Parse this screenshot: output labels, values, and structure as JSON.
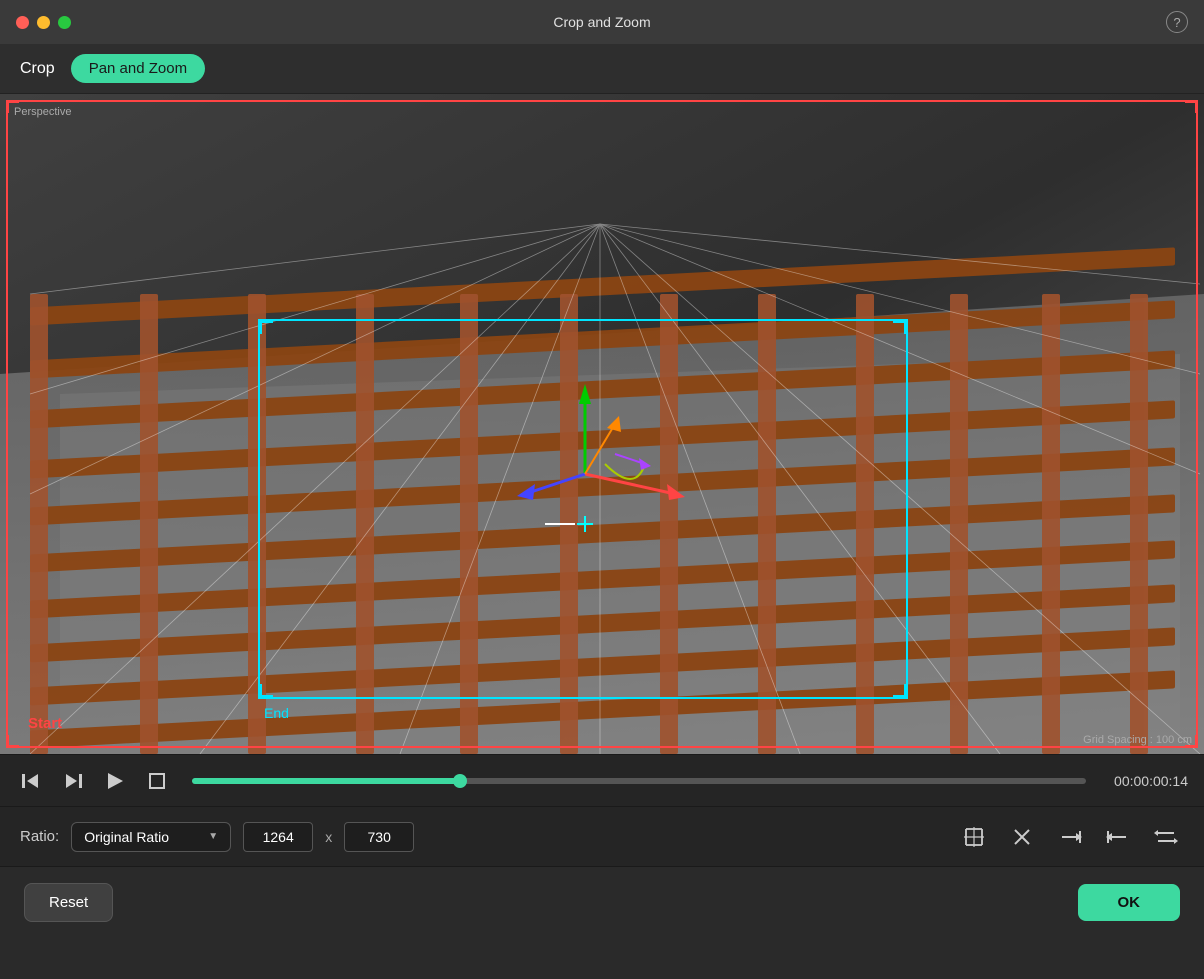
{
  "titlebar": {
    "title": "Crop and Zoom",
    "help_label": "?"
  },
  "tabs": {
    "crop_label": "Crop",
    "panzoom_label": "Pan and Zoom"
  },
  "viewport": {
    "perspective_label": "Perspective",
    "start_label": "Start",
    "end_label": "End",
    "grid_spacing_label": "Grid Spacing : 100 cm"
  },
  "transport": {
    "timecode": "00:00:00:14"
  },
  "ratio": {
    "label": "Ratio:",
    "selected": "Original Ratio",
    "width": "1264",
    "height": "730",
    "x_separator": "x"
  },
  "actions": {
    "reset_label": "Reset",
    "ok_label": "OK"
  },
  "icons": {
    "step_back": "⟨|",
    "step_fwd": "|▶",
    "play": "▷",
    "stop": "□",
    "crop_icon": "⤡",
    "close_icon": "✕",
    "trim_right": "→|",
    "trim_left": "|←",
    "swap": "⇦"
  }
}
